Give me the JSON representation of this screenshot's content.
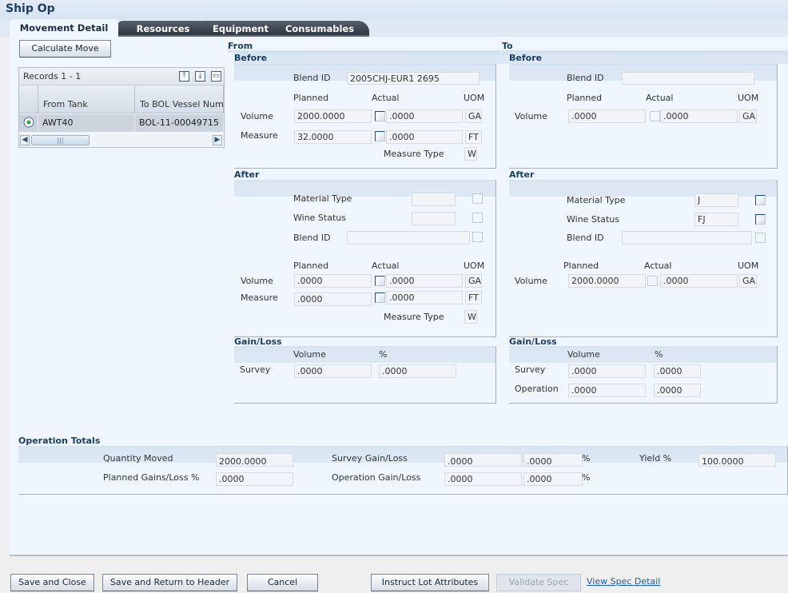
{
  "window": {
    "title": "Ship Op"
  },
  "tabs": [
    {
      "label": "Movement Detail",
      "active": true
    },
    {
      "label": "Resources",
      "active": false
    },
    {
      "label": "Equipment",
      "active": false
    },
    {
      "label": "Consumables",
      "active": false
    }
  ],
  "calculate_move_label": "Calculate Move",
  "grid": {
    "records_label": "Records 1 - 1",
    "icons": [
      "export-icon",
      "import-icon",
      "maximize-icon"
    ],
    "columns": [
      "From Tank",
      "To BOL Vessel Number"
    ],
    "rows": [
      {
        "selected": true,
        "from_tank": "AWT40",
        "to_bol_vessel_number": "BOL-11-00049715"
      }
    ]
  },
  "from": {
    "heading": "From",
    "before": {
      "heading": "Before",
      "blend_id_label": "Blend ID",
      "blend_id": "2005CHJ-EUR1  2695",
      "col_planned": "Planned",
      "col_actual": "Actual",
      "col_uom": "UOM",
      "volume_label": "Volume",
      "volume_planned": "2000.0000",
      "volume_actual": ".0000",
      "volume_uom": "GA",
      "measure_label": "Measure",
      "measure_planned": "32.0000",
      "measure_actual": ".0000",
      "measure_uom": "FT",
      "measure_type_label": "Measure Type",
      "measure_type": "W"
    },
    "after": {
      "heading": "After",
      "material_type_label": "Material Type",
      "material_type": "",
      "wine_status_label": "Wine Status",
      "wine_status": "",
      "blend_id_label": "Blend ID",
      "blend_id": "",
      "col_planned": "Planned",
      "col_actual": "Actual",
      "col_uom": "UOM",
      "volume_label": "Volume",
      "volume_planned": ".0000",
      "volume_actual": ".0000",
      "volume_uom": "GA",
      "measure_label": "Measure",
      "measure_planned": ".0000",
      "measure_actual": ".0000",
      "measure_uom": "FT",
      "measure_type_label": "Measure Type",
      "measure_type": "W"
    },
    "gain_loss": {
      "heading": "Gain/Loss",
      "col_volume": "Volume",
      "col_pct": "%",
      "survey_label": "Survey",
      "survey_volume": ".0000",
      "survey_pct": ".0000"
    }
  },
  "to": {
    "heading": "To",
    "before": {
      "heading": "Before",
      "blend_id_label": "Blend ID",
      "blend_id": "",
      "col_planned": "Planned",
      "col_actual": "Actual",
      "col_uom": "UOM",
      "volume_label": "Volume",
      "volume_planned": ".0000",
      "volume_actual": ".0000",
      "volume_uom": "GA"
    },
    "after": {
      "heading": "After",
      "material_type_label": "Material Type",
      "material_type": "J",
      "wine_status_label": "Wine Status",
      "wine_status": "FJ",
      "blend_id_label": "Blend ID",
      "blend_id": "",
      "col_planned": "Planned",
      "col_actual": "Actual",
      "col_uom": "UOM",
      "volume_label": "Volume",
      "volume_planned": "2000.0000",
      "volume_actual": ".0000",
      "volume_uom": "GA"
    },
    "gain_loss": {
      "heading": "Gain/Loss",
      "col_volume": "Volume",
      "col_pct": "%",
      "survey_label": "Survey",
      "survey_volume": ".0000",
      "survey_pct": ".0000",
      "operation_label": "Operation",
      "operation_volume": ".0000",
      "operation_pct": ".0000"
    }
  },
  "totals": {
    "heading": "Operation Totals",
    "quantity_moved_label": "Quantity Moved",
    "quantity_moved": "2000.0000",
    "planned_gains_label": "Planned Gains/Loss %",
    "planned_gains": ".0000",
    "survey_gl_label": "Survey Gain/Loss",
    "survey_gl_value": ".0000",
    "survey_gl_pct": ".0000",
    "operation_gl_label": "Operation Gain/Loss",
    "operation_gl_value": ".0000",
    "operation_gl_pct": ".0000",
    "pct_sign": "%",
    "yield_label": "Yield %",
    "yield": "100.0000"
  },
  "footer": {
    "save_close": "Save and Close",
    "save_return": "Save and Return to Header",
    "cancel": "Cancel",
    "instruct_lot": "Instruct Lot Attributes",
    "validate_spec": "Validate Spec",
    "view_spec_detail": "View Spec Detail"
  }
}
